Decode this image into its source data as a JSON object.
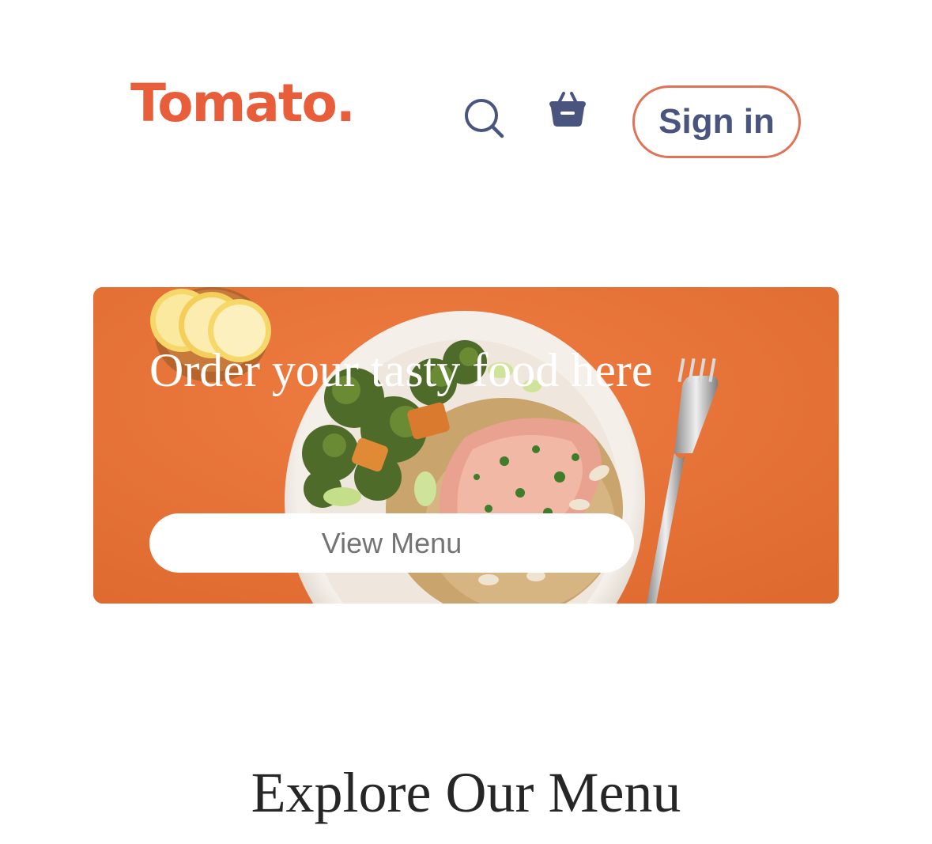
{
  "header": {
    "logo": "Tomato.",
    "search_icon": "search-icon",
    "basket_icon": "basket-icon",
    "signin_label": "Sign in"
  },
  "hero": {
    "title": "Order your tasty food here",
    "button_label": "View Menu"
  },
  "menu_section": {
    "title": "Explore Our Menu"
  },
  "colors": {
    "brand": "#e85d3a",
    "navy": "#49557e",
    "hero_bg": "#e8743a",
    "signin_border": "#e07257"
  }
}
